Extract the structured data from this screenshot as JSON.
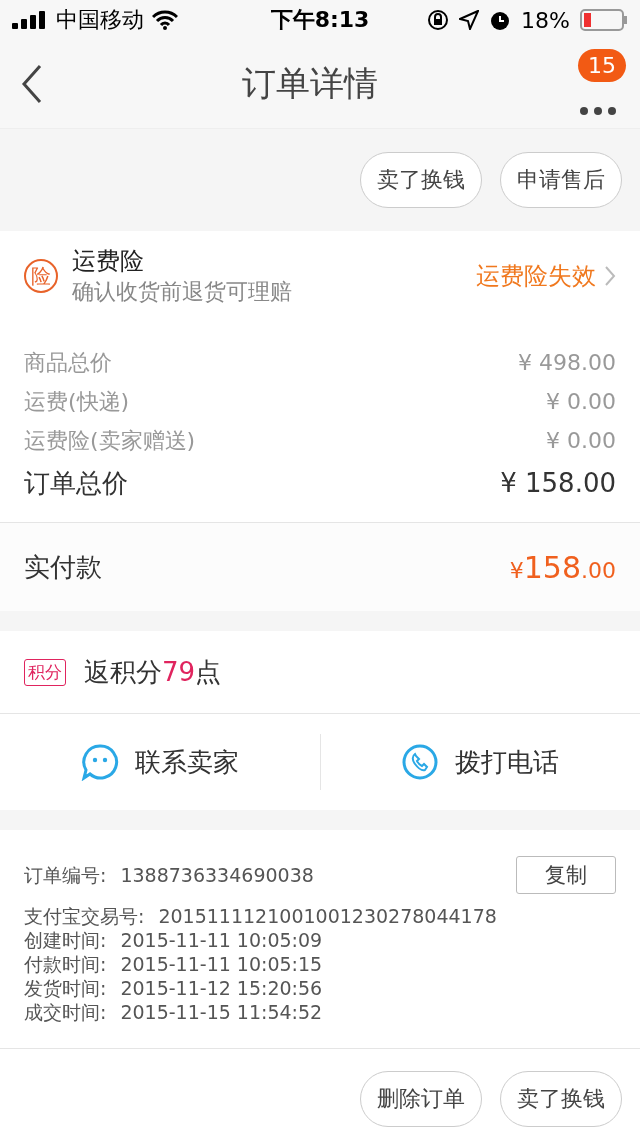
{
  "status_bar": {
    "carrier": "中国移动",
    "time": "下午8:13",
    "battery_text": "18%"
  },
  "nav": {
    "title": "订单详情",
    "badge": "15"
  },
  "top_actions": [
    "卖了换钱",
    "申请售后"
  ],
  "insurance": {
    "badge": "险",
    "title": "运费险",
    "subtitle": "确认收货前退货可理赔",
    "status": "运费险失效"
  },
  "price_rows": [
    {
      "label": "商品总价",
      "value": "¥ 498.00",
      "kind": "minor"
    },
    {
      "label": "运费(快递)",
      "value": "¥ 0.00",
      "kind": "minor"
    },
    {
      "label": "运费险(卖家赠送)",
      "value": "¥ 0.00",
      "kind": "minor"
    },
    {
      "label": "订单总价",
      "value": "¥ 158.00",
      "kind": "total"
    }
  ],
  "paid": {
    "label": "实付款",
    "currency": "¥",
    "integer": "158",
    "decimal": ".00"
  },
  "points": {
    "tag": "积分",
    "before": "返积分",
    "value": "79",
    "after": "点"
  },
  "contact": [
    {
      "label": "联系卖家",
      "kind": "chat"
    },
    {
      "label": "拨打电话",
      "kind": "phone"
    }
  ],
  "order_info": [
    {
      "label": "订单编号:",
      "value": "1388736334690038",
      "copy": "复制"
    },
    {
      "label": "支付宝交易号:",
      "value": "2015111121001001230278044178"
    },
    {
      "label": "创建时间:",
      "value": "2015-11-11 10:05:09"
    },
    {
      "label": "付款时间:",
      "value": "2015-11-11 10:05:15"
    },
    {
      "label": "发货时间:",
      "value": "2015-11-12 15:20:56"
    },
    {
      "label": "成交时间:",
      "value": "2015-11-15 11:54:52"
    }
  ],
  "bottom_actions": [
    "删除订单",
    "卖了换钱"
  ]
}
